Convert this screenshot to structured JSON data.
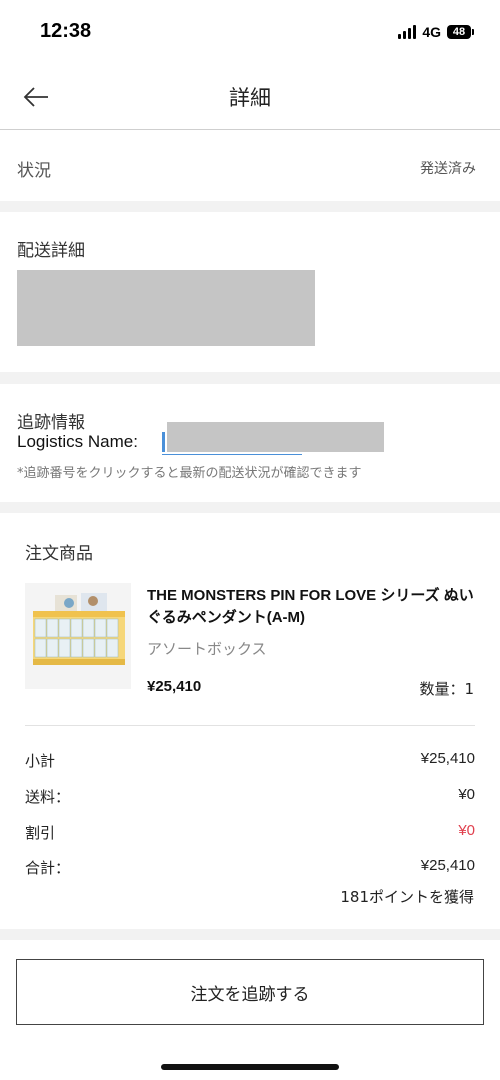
{
  "status_bar": {
    "time": "12:38",
    "network": "4G",
    "battery": "48"
  },
  "nav": {
    "title": "詳細",
    "back_icon": "arrow-left-icon"
  },
  "order_status": {
    "label": "状況",
    "value": "発送済み"
  },
  "delivery": {
    "title": "配送詳細"
  },
  "tracking": {
    "title": "追跡情報",
    "logistics_label": "Logistics Name:",
    "note": "*追跡番号をクリックすると最新の配送状況が確認できます"
  },
  "order_items": {
    "title": "注文商品",
    "items": [
      {
        "name": "THE MONSTERS PIN FOR LOVE シリーズ ぬいぐるみペンダント(A-M)",
        "variant": "アソートボックス",
        "price": "¥25,410",
        "quantity": "数量：1"
      }
    ]
  },
  "summary": {
    "subtotal_label": "小計",
    "subtotal_value": "¥25,410",
    "shipping_label": "送料：",
    "shipping_value": "¥0",
    "discount_label": "割引",
    "discount_value": "¥0",
    "total_label": "合計：",
    "total_value": "¥25,410",
    "points": "181ポイントを獲得"
  },
  "actions": {
    "track_order_label": "注文を追跡する"
  },
  "colors": {
    "discount": "#e0404e",
    "link": "#4a90d9",
    "section_gap": "#f2f2f2"
  }
}
